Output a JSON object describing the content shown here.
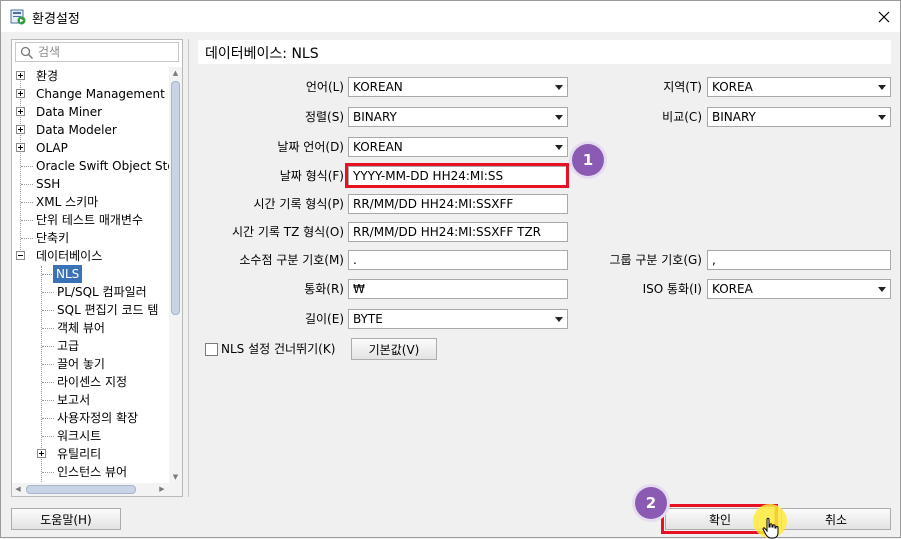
{
  "window": {
    "title": "환경설정",
    "icons": {
      "app": "preferences-app-icon",
      "close": "close-icon"
    }
  },
  "sidebar": {
    "search_placeholder": "검색",
    "items": [
      {
        "label": "환경",
        "expander": "plus"
      },
      {
        "label": "Change Management D",
        "expander": "plus"
      },
      {
        "label": "Data Miner",
        "expander": "plus"
      },
      {
        "label": "Data Modeler",
        "expander": "plus"
      },
      {
        "label": "OLAP",
        "expander": "plus"
      },
      {
        "label": "Oracle Swift Object Sto",
        "expander": "none"
      },
      {
        "label": "SSH",
        "expander": "none"
      },
      {
        "label": "XML 스키마",
        "expander": "none"
      },
      {
        "label": "단위 테스트 매개변수",
        "expander": "none"
      },
      {
        "label": "단축키",
        "expander": "none"
      },
      {
        "label": "데이터베이스",
        "expander": "minus"
      },
      {
        "label": "NLS",
        "expander": "none",
        "selected": true
      },
      {
        "label": "PL/SQL 컴파일러",
        "expander": "none"
      },
      {
        "label": "SQL 편집기 코드 템",
        "expander": "none"
      },
      {
        "label": "객체 뷰어",
        "expander": "none"
      },
      {
        "label": "고급",
        "expander": "none"
      },
      {
        "label": "끌어 놓기",
        "expander": "none"
      },
      {
        "label": "라이센스 지정",
        "expander": "none"
      },
      {
        "label": "보고서",
        "expander": "none"
      },
      {
        "label": "사용자정의 확장",
        "expander": "none"
      },
      {
        "label": "워크시트",
        "expander": "none"
      },
      {
        "label": "유틸리티",
        "expander": "plus"
      },
      {
        "label": "인스턴스 뷰어",
        "expander": "none"
      }
    ]
  },
  "header": {
    "title": "데이터베이스: NLS"
  },
  "form": {
    "language": {
      "label": "언어(L)",
      "value": "KOREAN"
    },
    "territory": {
      "label": "지역(T)",
      "value": "KOREA"
    },
    "sort": {
      "label": "정렬(S)",
      "value": "BINARY"
    },
    "comparison": {
      "label": "비교(C)",
      "value": "BINARY"
    },
    "date_language": {
      "label": "날짜 언어(D)",
      "value": "KOREAN"
    },
    "date_format": {
      "label": "날짜 형식(F)",
      "value": "YYYY-MM-DD HH24:MI:SS"
    },
    "timestamp_format": {
      "label": "시간 기록 형식(P)",
      "value": "RR/MM/DD HH24:MI:SSXFF"
    },
    "timestamp_tz_format": {
      "label": "시간 기록 TZ 형식(O)",
      "value": "RR/MM/DD HH24:MI:SSXFF TZR"
    },
    "decimal_separator": {
      "label": "소수점 구분 기호(M)",
      "value": "."
    },
    "group_separator": {
      "label": "그룹 구분 기호(G)",
      "value": ","
    },
    "currency": {
      "label": "통화(R)",
      "value": "₩"
    },
    "iso_currency": {
      "label": "ISO 통화(I)",
      "value": "KOREA"
    },
    "length": {
      "label": "길이(E)",
      "value": "BYTE"
    },
    "skip_nls": {
      "label": "NLS 설정 건너뛰기(K)",
      "checked": false
    },
    "defaults_button": "기본값(V)"
  },
  "footer": {
    "help_button": "도움말(H)",
    "ok_button": "확인",
    "cancel_button": "취소"
  },
  "annotations": {
    "badge_1": "1",
    "badge_2": "2",
    "highlight_color": "#e81123",
    "badge_color": "#8b5bb4"
  },
  "colors": {
    "selection": "#3a72b8",
    "panel_bg": "#f0f0f0"
  }
}
